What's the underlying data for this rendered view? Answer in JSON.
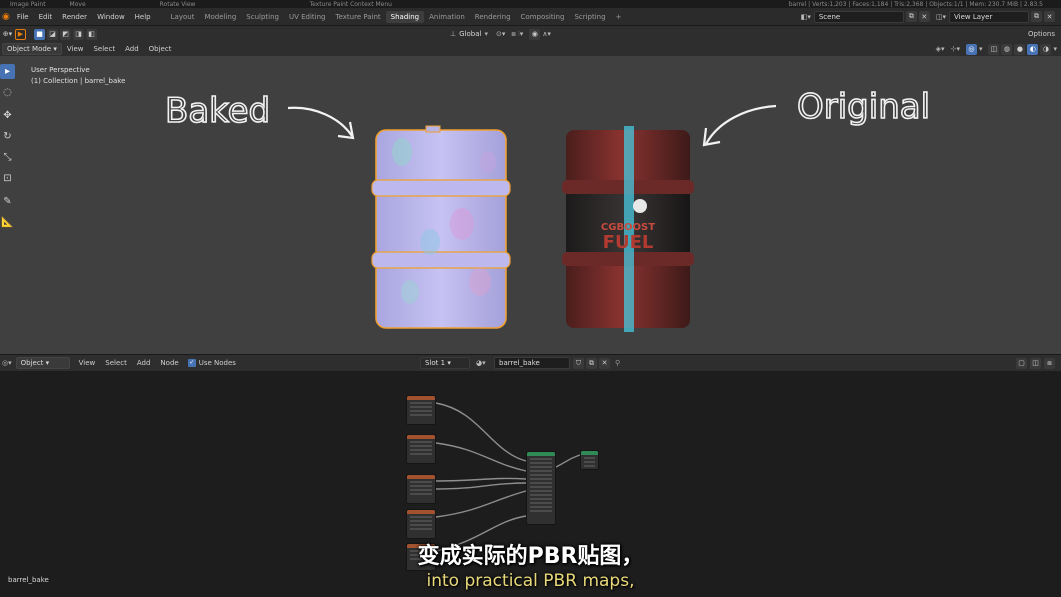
{
  "statusbar": {
    "items": [
      "Image Paint",
      "Move",
      "Rotate View",
      "Texture Paint Context Menu"
    ],
    "stats": "barrel | Verts:1,203 | Faces:1,184 | Tris:2,368 | Objects:1/1 | Mem: 230.7 MiB | 2.83.5"
  },
  "menu": [
    "File",
    "Edit",
    "Render",
    "Window",
    "Help"
  ],
  "workspaces": [
    "Layout",
    "Modeling",
    "Sculpting",
    "UV Editing",
    "Texture Paint",
    "Shading",
    "Animation",
    "Rendering",
    "Compositing",
    "Scripting"
  ],
  "active_workspace": "Shading",
  "scene": {
    "label": "Scene",
    "view_layer": "View Layer"
  },
  "viewport_header": {
    "mode": "Object Mode",
    "menus": [
      "View",
      "Select",
      "Add",
      "Object"
    ],
    "transform": "Global",
    "options": "Options"
  },
  "viewport": {
    "perspective": "User Perspective",
    "collection": "(1) Collection | barrel_bake",
    "baked_label": "Baked",
    "original_label": "Original",
    "barrel_text_1": "CGBOOST",
    "barrel_text_2": "FUEL"
  },
  "node_header": {
    "type": "Object",
    "menus": [
      "View",
      "Select",
      "Add",
      "Node"
    ],
    "use_nodes": "Use Nodes",
    "slot": "Slot 1",
    "material": "barrel_bake"
  },
  "node_editor": {
    "material_name": "barrel_bake"
  },
  "subtitles": {
    "zh": "变成实际的PBR贴图，",
    "en": "into practical PBR maps,"
  },
  "colors": {
    "accent": "#4772b3",
    "subtitle": "#e8d87a",
    "select": "#f0a030"
  }
}
